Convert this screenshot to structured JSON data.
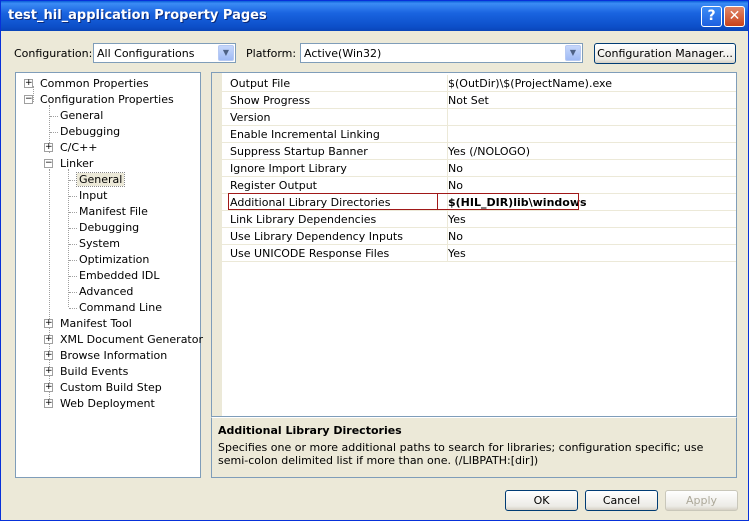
{
  "window": {
    "title": "test_hil_application Property Pages",
    "help_glyph": "?",
    "close_glyph": "✕"
  },
  "toolbar": {
    "configuration_label": "Configuration:",
    "configuration_value": "All Configurations",
    "platform_label": "Platform:",
    "platform_value": "Active(Win32)",
    "config_manager_label": "Configuration Manager..."
  },
  "tree": {
    "items": [
      {
        "label": "Common Properties",
        "expander": "+"
      },
      {
        "label": "Configuration Properties",
        "expander": "−"
      },
      {
        "label": "General"
      },
      {
        "label": "Debugging"
      },
      {
        "label": "C/C++",
        "expander": "+"
      },
      {
        "label": "Linker",
        "expander": "−"
      },
      {
        "label": "General",
        "selected": true
      },
      {
        "label": "Input"
      },
      {
        "label": "Manifest File"
      },
      {
        "label": "Debugging"
      },
      {
        "label": "System"
      },
      {
        "label": "Optimization"
      },
      {
        "label": "Embedded IDL"
      },
      {
        "label": "Advanced"
      },
      {
        "label": "Command Line"
      },
      {
        "label": "Manifest Tool",
        "expander": "+"
      },
      {
        "label": "XML Document Generator",
        "expander": "+"
      },
      {
        "label": "Browse Information",
        "expander": "+"
      },
      {
        "label": "Build Events",
        "expander": "+"
      },
      {
        "label": "Custom Build Step",
        "expander": "+"
      },
      {
        "label": "Web Deployment",
        "expander": "+"
      }
    ]
  },
  "properties": [
    {
      "name": "Output File",
      "value": "$(OutDir)\\$(ProjectName).exe"
    },
    {
      "name": "Show Progress",
      "value": "Not Set"
    },
    {
      "name": "Version",
      "value": ""
    },
    {
      "name": "Enable Incremental Linking",
      "value": ""
    },
    {
      "name": "Suppress Startup Banner",
      "value": "Yes (/NOLOGO)"
    },
    {
      "name": "Ignore Import Library",
      "value": "No"
    },
    {
      "name": "Register Output",
      "value": "No"
    },
    {
      "name": "Additional Library Directories",
      "value": "$(HIL_DIR)lib\\windows",
      "highlighted": true
    },
    {
      "name": "Link Library Dependencies",
      "value": "Yes"
    },
    {
      "name": "Use Library Dependency Inputs",
      "value": "No"
    },
    {
      "name": "Use UNICODE Response Files",
      "value": "Yes"
    }
  ],
  "description": {
    "title": "Additional Library Directories",
    "text": "Specifies one or more additional paths to search for libraries; configuration specific; use semi-colon delimited list if more than one.     (/LIBPATH:[dir])"
  },
  "buttons": {
    "ok": "OK",
    "cancel": "Cancel",
    "apply": "Apply"
  },
  "colors": {
    "titlebar": "#0a5fd8",
    "dialog_bg": "#ece9d8",
    "highlight_border": "#a01818"
  }
}
